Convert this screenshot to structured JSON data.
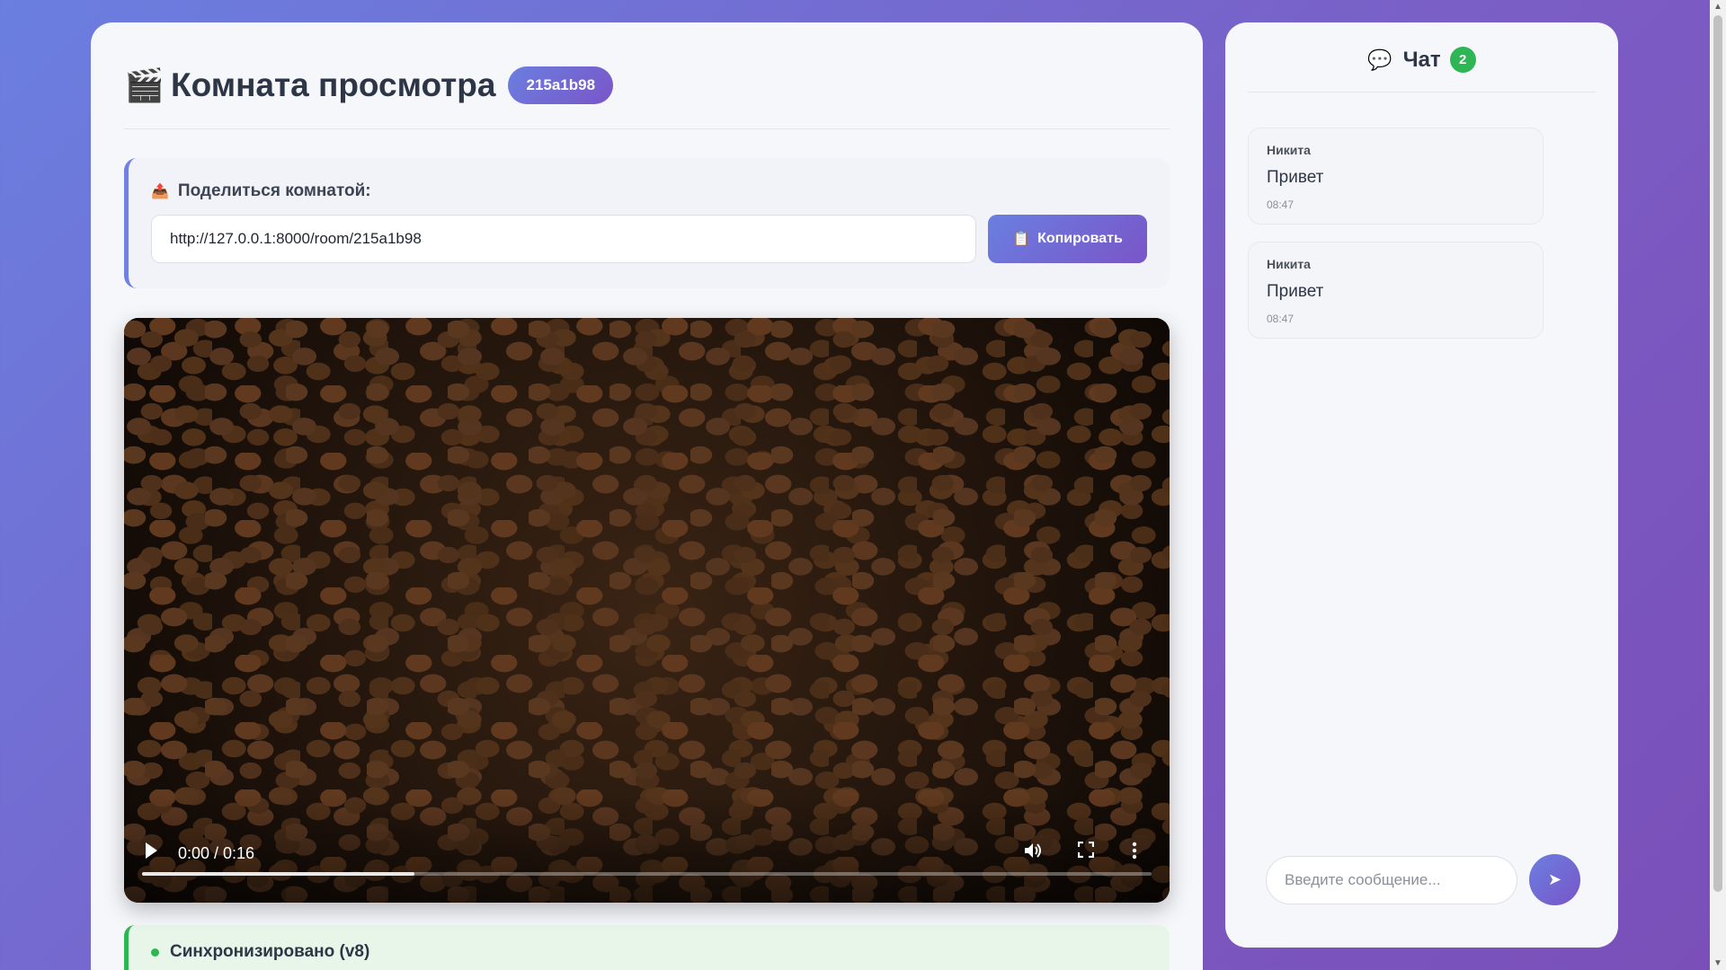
{
  "room": {
    "title": "Комната просмотра",
    "id_badge": "215a1b98",
    "icon": "clapperboard-icon"
  },
  "share": {
    "label": "Поделиться комнатой:",
    "url": "http://127.0.0.1:8000/room/215a1b98",
    "copy_label": "Копировать",
    "icon": "outbox-icon"
  },
  "player": {
    "time_display": "0:00 / 0:16",
    "progress_fraction": 0.27
  },
  "sync": {
    "status": "Синхронизировано (v8)",
    "color": "#2db653"
  },
  "chat": {
    "title": "Чат",
    "count": "2",
    "messages": [
      {
        "author": "Никита",
        "text": "Привет",
        "time": "08:47"
      },
      {
        "author": "Никита",
        "text": "Привет",
        "time": "08:47"
      }
    ],
    "input_placeholder": "Введите сообщение...",
    "send_icon": "send-icon"
  },
  "colors": {
    "accent": "#6a7fe0",
    "accent2": "#7a55c8",
    "success": "#2db653"
  }
}
